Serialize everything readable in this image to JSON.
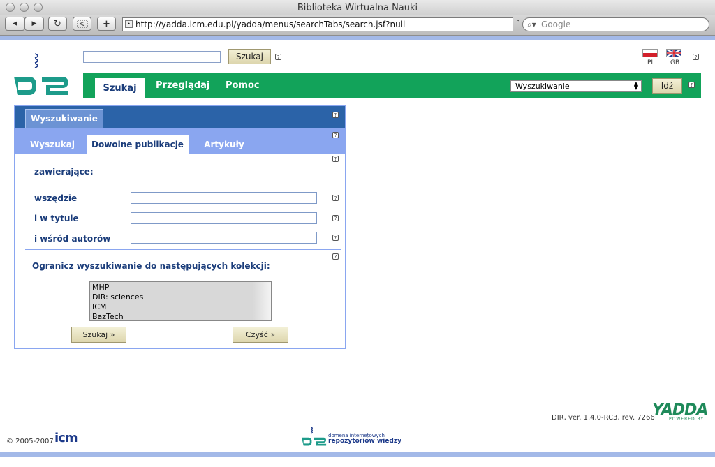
{
  "browser": {
    "window_title": "Biblioteka Wirtualna Nauki",
    "url": "http://yadda.icm.edu.pl/yadda/menus/searchTabs/search.jsf?null",
    "search_placeholder": "Google",
    "back_icon": "◀",
    "forward_icon": "▶",
    "reload_icon": "↻",
    "add_icon": "+"
  },
  "header": {
    "search_button": "Szukaj",
    "help": "?",
    "languages": [
      {
        "code": "PL",
        "flag": "poland-flag-icon"
      },
      {
        "code": "GB",
        "flag": "uk-flag-icon"
      }
    ]
  },
  "nav": {
    "tabs": [
      "Szukaj",
      "Przeglądaj",
      "Pomoc"
    ],
    "active_tab": "Szukaj",
    "select_value": "Wyszukiwanie",
    "go_button": "Idź",
    "color": "#12a35a"
  },
  "panel": {
    "title": "Wyszukiwanie",
    "subtabs": [
      "Wyszukaj",
      "Dowolne publikacje",
      "Artykuły"
    ],
    "active_subtab": "Dowolne publikacje",
    "containing_label": "zawierające:",
    "fields": [
      {
        "label": "wszędzie",
        "value": ""
      },
      {
        "label": "i w tytule",
        "value": ""
      },
      {
        "label": "i wśród autorów",
        "value": ""
      }
    ],
    "collections_label": "Ogranicz wyszukiwanie do następujących kolekcji:",
    "collections": [
      "MHP",
      "DIR: sciences",
      "ICM",
      "BazTech"
    ],
    "search_button": "Szukaj »",
    "clear_button": "Czyść »"
  },
  "footer": {
    "version": "DIR, ver. 1.4.0-RC3, rev. 7266",
    "yadda_logo": "YADDA",
    "powered_by": "POWERED BY",
    "copyright": "© 2005-2007",
    "icm_logo": "icm",
    "d2_line1": "domena internetowych",
    "d2_line2": "repozytoriów wiedzy"
  }
}
